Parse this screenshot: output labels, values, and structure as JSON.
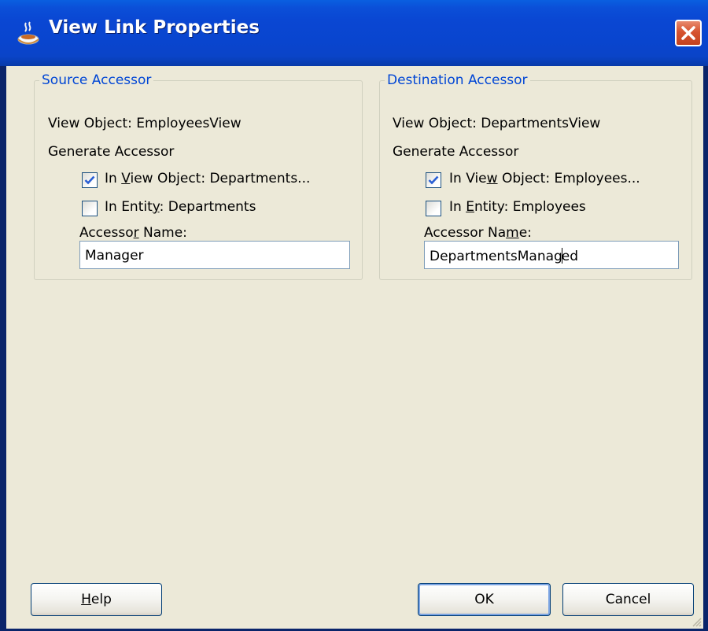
{
  "window": {
    "title": "View Link Properties"
  },
  "source": {
    "group_title": "Source Accessor",
    "view_object": "View Object: EmployeesView",
    "generate_label": "Generate Accessor",
    "in_view_object": {
      "pre": "In ",
      "mnemonic": "V",
      "post": "iew Object: Departments...",
      "checked": true
    },
    "in_entity": {
      "pre": "In Entit",
      "mnemonic": "y",
      "post": ": Departments",
      "checked": false
    },
    "accessor_name_label": {
      "pre": "Accesso",
      "mnemonic": "r",
      "post": " Name:"
    },
    "accessor_name_value": "Manager"
  },
  "destination": {
    "group_title": "Destination Accessor",
    "view_object": "View Object: DepartmentsView",
    "generate_label": "Generate Accessor",
    "in_view_object": {
      "pre": "In Vie",
      "mnemonic": "w",
      "post": " Object: Employees...",
      "checked": true
    },
    "in_entity": {
      "pre": "In ",
      "mnemonic": "E",
      "post": "ntity: Employees",
      "checked": false
    },
    "accessor_name_label": {
      "pre": "Accessor Na",
      "mnemonic": "m",
      "post": "e:"
    },
    "accessor_name_value_before_caret": "DepartmentsManag",
    "accessor_name_value_after_caret": "ed"
  },
  "buttons": {
    "help": {
      "mnemonic": "H",
      "rest": "elp"
    },
    "ok": "OK",
    "cancel": "Cancel"
  },
  "icons": [
    "coffee-cup-icon",
    "close-icon",
    "checkmark-icon",
    "resize-grip-icon"
  ],
  "colors": {
    "titlebar": "#0a47d3",
    "dialog_bg": "#ece9d8",
    "group_title": "#0046d5",
    "checkmark": "#2a5fd4"
  }
}
